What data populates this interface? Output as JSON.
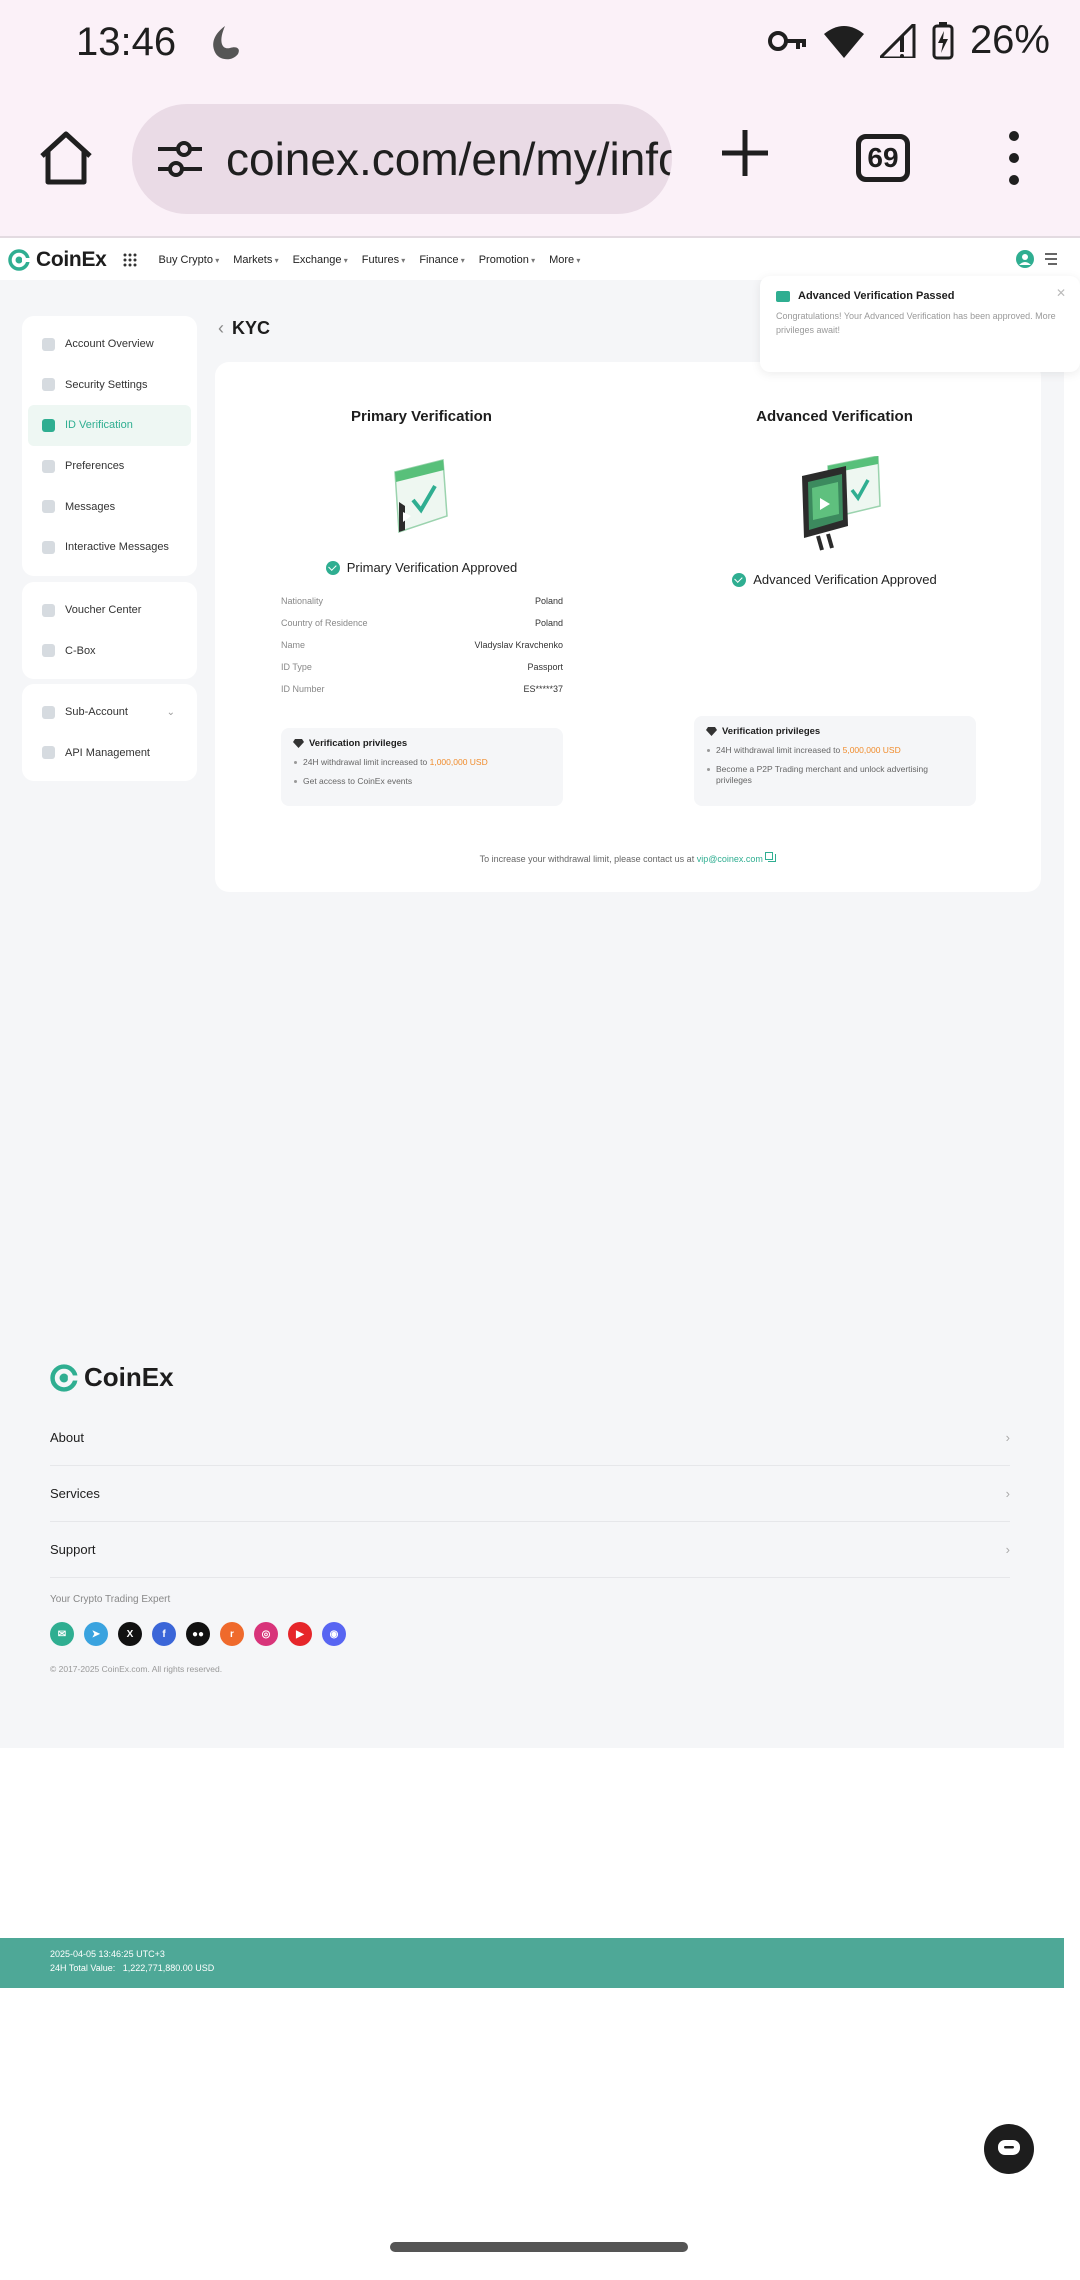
{
  "status_bar": {
    "time": "13:46",
    "battery": "26%"
  },
  "browser": {
    "url": "coinex.com/en/my/info",
    "tab_count": "69"
  },
  "brand": {
    "name": "CoinEx",
    "accent": "#2fae91"
  },
  "nav": {
    "items": [
      "Buy Crypto",
      "Markets",
      "Exchange",
      "Futures",
      "Finance",
      "Promotion",
      "More"
    ]
  },
  "sidebar": {
    "group1": [
      "Account Overview",
      "Security Settings",
      "ID Verification",
      "Preferences",
      "Messages",
      "Interactive Messages"
    ],
    "group2": [
      "Voucher Center",
      "C-Box"
    ],
    "group3": [
      "Sub-Account",
      "API Management"
    ]
  },
  "page": {
    "title": "KYC"
  },
  "primary": {
    "heading": "Primary Verification",
    "status": "Primary Verification Approved",
    "info": [
      {
        "k": "Nationality",
        "v": "Poland"
      },
      {
        "k": "Country of Residence",
        "v": "Poland"
      },
      {
        "k": "Name",
        "v": "Vladyslav Kravchenko"
      },
      {
        "k": "ID Type",
        "v": "Passport"
      },
      {
        "k": "ID Number",
        "v": "ES*****37"
      }
    ],
    "privileges_title": "Verification privileges",
    "priv1_prefix": "24H withdrawal limit increased to ",
    "priv1_amount": "1,000,000 USD",
    "priv2": "Get access to CoinEx events"
  },
  "advanced": {
    "heading": "Advanced Verification",
    "status": "Advanced Verification Approved",
    "privileges_title": "Verification privileges",
    "priv1_prefix": "24H withdrawal limit increased to ",
    "priv1_amount": "5,000,000 USD",
    "priv2": "Become a P2P Trading merchant and unlock advertising privileges"
  },
  "contact": {
    "prefix": "To increase your withdrawal limit, please contact us at ",
    "email": "vip@coinex.com"
  },
  "toast": {
    "title": "Advanced Verification Passed",
    "body": "Congratulations! Your Advanced Verification has been approved. More privileges await!"
  },
  "footer": {
    "rows": [
      "About",
      "Services",
      "Support"
    ],
    "tagline": "Your Crypto Trading Expert",
    "copyright": "© 2017-2025 CoinEx.com. All rights reserved.",
    "date_line": "2025-04-05 13:46:25 UTC+3",
    "total_label": "24H Total Value:",
    "total_value": "1,222,771,880.00 USD"
  },
  "socials": [
    {
      "name": "email-icon",
      "color": "#2fae91",
      "glyph": "✉"
    },
    {
      "name": "telegram-icon",
      "color": "#3aa3df",
      "glyph": "➤"
    },
    {
      "name": "x-icon",
      "color": "#111111",
      "glyph": "X"
    },
    {
      "name": "facebook-icon",
      "color": "#3b66d8",
      "glyph": "f"
    },
    {
      "name": "medium-icon",
      "color": "#111111",
      "glyph": "●●"
    },
    {
      "name": "reddit-icon",
      "color": "#ef6a2c",
      "glyph": "r"
    },
    {
      "name": "instagram-icon",
      "color": "#d8347a",
      "glyph": "◎"
    },
    {
      "name": "youtube-icon",
      "color": "#e6262a",
      "glyph": "▶"
    },
    {
      "name": "discord-icon",
      "color": "#5865f2",
      "glyph": "◉"
    }
  ]
}
